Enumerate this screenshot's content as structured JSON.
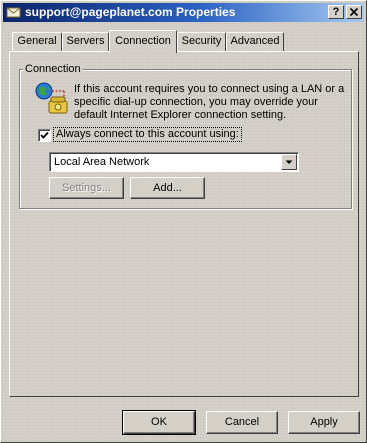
{
  "window": {
    "title": "support@pageplanet.com Properties",
    "help_button": "?",
    "close_button": "✕"
  },
  "tabs": [
    {
      "label": "General",
      "active": false
    },
    {
      "label": "Servers",
      "active": false
    },
    {
      "label": "Connection",
      "active": true
    },
    {
      "label": "Security",
      "active": false
    },
    {
      "label": "Advanced",
      "active": false
    }
  ],
  "connection": {
    "group_label": "Connection",
    "info_text": "If this account requires you to connect using a LAN or a specific dial-up connection, you may override your default Internet Explorer connection setting.",
    "always_connect": {
      "checked": true,
      "label": "Always connect to this account using:"
    },
    "connection_select": {
      "value": "Local Area Network"
    },
    "settings_button": {
      "label": "Settings...",
      "enabled": false
    },
    "add_button": {
      "label": "Add...",
      "enabled": true
    }
  },
  "footer": {
    "ok_label": "OK",
    "cancel_label": "Cancel",
    "apply_label": "Apply"
  },
  "colors": {
    "title_active_start": "#0a246a",
    "title_active_end": "#a6caf0",
    "face": "#d4d0c8"
  }
}
